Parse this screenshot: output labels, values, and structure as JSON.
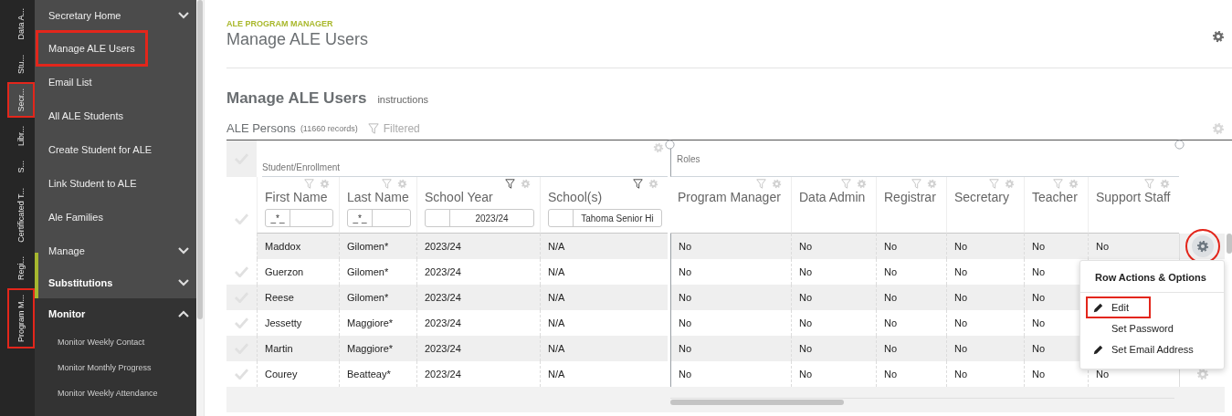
{
  "side_tabs": [
    {
      "label": "Data A...",
      "selected": false,
      "highlighted": false
    },
    {
      "label": "Stu...",
      "selected": false,
      "highlighted": false
    },
    {
      "label": "Secr...",
      "selected": true,
      "highlighted": true
    },
    {
      "label": "Libr...",
      "selected": false,
      "highlighted": false
    },
    {
      "label": "S...",
      "selected": false,
      "highlighted": false
    },
    {
      "label": "Certificated T...",
      "selected": false,
      "highlighted": false
    },
    {
      "label": "Regi...",
      "selected": false,
      "highlighted": false
    },
    {
      "label": "Program M...",
      "selected": false,
      "highlighted": true
    }
  ],
  "nav": [
    {
      "label": "Secretary Home",
      "kind": "section",
      "expanded": false,
      "highlighted": false
    },
    {
      "label": "Manage ALE Users",
      "kind": "link",
      "highlighted": true
    },
    {
      "label": "Email List",
      "kind": "link",
      "highlighted": false
    },
    {
      "label": "All ALE Students",
      "kind": "link",
      "highlighted": false
    },
    {
      "label": "Create Student for ALE",
      "kind": "link",
      "highlighted": false
    },
    {
      "label": "Link Student to ALE",
      "kind": "link",
      "highlighted": false
    },
    {
      "label": "Ale Families",
      "kind": "link",
      "highlighted": false
    },
    {
      "label": "Manage",
      "kind": "section",
      "expanded": false,
      "highlighted": false
    },
    {
      "label": "Substitutions",
      "kind": "group",
      "expanded": false,
      "selected": true
    },
    {
      "label": "Monitor",
      "kind": "group",
      "expanded": true,
      "selected": false,
      "children": [
        {
          "label": "Monitor Weekly Contact"
        },
        {
          "label": "Monitor Monthly Progress"
        },
        {
          "label": "Monitor Weekly Attendance"
        }
      ]
    }
  ],
  "page": {
    "eyebrow": "ALE PROGRAM MANAGER",
    "title": "Manage ALE Users"
  },
  "section": {
    "title": "Manage ALE Users",
    "link": "instructions"
  },
  "list": {
    "title": "ALE Persons",
    "count": "(11660 records)",
    "filter_label": "Filtered"
  },
  "groups": [
    {
      "label": "Student/Enrollment",
      "columns": [
        {
          "label": "First Name",
          "filter_active": false,
          "filter_mode": "_*_"
        },
        {
          "label": "Last Name",
          "filter_active": false,
          "filter_mode": "_*_"
        },
        {
          "label": "School Year",
          "filter_active": true,
          "filter_value": "2023/24"
        },
        {
          "label": "School(s)",
          "filter_active": true,
          "filter_value": "Tahoma Senior Hi"
        }
      ]
    },
    {
      "label": "Roles",
      "columns": [
        {
          "label": "Program Manager",
          "filter_active": false
        },
        {
          "label": "Data Admin",
          "filter_active": false
        },
        {
          "label": "Registrar",
          "filter_active": false
        },
        {
          "label": "Secretary",
          "filter_active": false
        },
        {
          "label": "Teacher",
          "filter_active": false
        },
        {
          "label": "Support Staff",
          "filter_active": false
        }
      ]
    }
  ],
  "rows": [
    {
      "selected": false,
      "cells": [
        "Maddox",
        "Gilomen*",
        "2023/24",
        "N/A",
        "No",
        "No",
        "No",
        "No",
        "No",
        "No"
      ],
      "gear": true,
      "circled": true
    },
    {
      "selected": false,
      "cells": [
        "Guerzon",
        "Gilomen*",
        "2023/24",
        "N/A",
        "No",
        "No",
        "No",
        "No",
        "No"
      ]
    },
    {
      "selected": false,
      "cells": [
        "Reese",
        "Gilomen*",
        "2023/24",
        "N/A",
        "No",
        "No",
        "No",
        "No",
        "No"
      ]
    },
    {
      "selected": false,
      "cells": [
        "Jessetty",
        "Maggiore*",
        "2023/24",
        "N/A",
        "No",
        "No",
        "No",
        "No",
        "No"
      ]
    },
    {
      "selected": false,
      "cells": [
        "Martin",
        "Maggiore*",
        "2023/24",
        "N/A",
        "No",
        "No",
        "No",
        "No",
        "No"
      ]
    },
    {
      "selected": false,
      "cells": [
        "Courey",
        "Beatteay*",
        "2023/24",
        "N/A",
        "No",
        "No",
        "No",
        "No",
        "No",
        "No"
      ],
      "gear": true,
      "circled": false
    }
  ],
  "menu": {
    "title": "Row Actions & Options",
    "items": [
      {
        "label": "Edit",
        "kind": "iconed",
        "highlighted": true
      },
      {
        "label": "Set Password",
        "kind": "plain",
        "highlighted": false
      },
      {
        "label": "Set Email Address",
        "kind": "iconed",
        "highlighted": false
      }
    ]
  }
}
